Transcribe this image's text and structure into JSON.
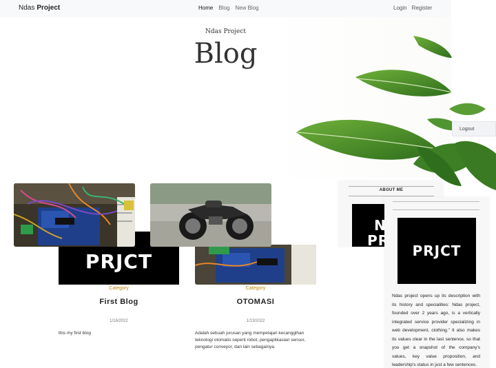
{
  "navbar": {
    "brand_prefix": "Ndas",
    "brand_strong": "Project",
    "links": [
      "Home",
      "Blog",
      "New Blog"
    ],
    "auth": [
      "Login",
      "Register"
    ]
  },
  "hero": {
    "subtitle": "Ndas Project",
    "title": "Blog"
  },
  "dropdown": {
    "logout_label": "Logout"
  },
  "logo_text": {
    "card": "PRJCT",
    "about_line1": "NDS",
    "about_line2": "PRJCT",
    "side": "PRJCT"
  },
  "cards": [
    {
      "category": "Category",
      "title": "First Blog",
      "date": "1/16/2022",
      "excerpt": "this my first blog"
    },
    {
      "category": "Category",
      "title": "OTOMASI",
      "date": "1/13/2022",
      "excerpt": "Adalah sebuah jurusan yang mempelajari kecanggihan teknologi otomatis seperti robot, pengaplikasian sensor, pengatur conveyor, dan lain sebagainya."
    }
  ],
  "sidebar": {
    "about_title": "ABOUT ME",
    "description": "Ndas project opens up its description with its history and specialities: Ndas project, founded over 2 years ago, is a vertically integrated service provider specializing in web development, clothing.\" It also makes its values clear in the last sentence, so that you get a snapshot of the company's values, key value proposition, and leadership's status in just a few sentences."
  },
  "colors": {
    "navbar_bg": "#f8f9fa",
    "category": "#b8860b",
    "leaf": "#4a8a2a"
  }
}
